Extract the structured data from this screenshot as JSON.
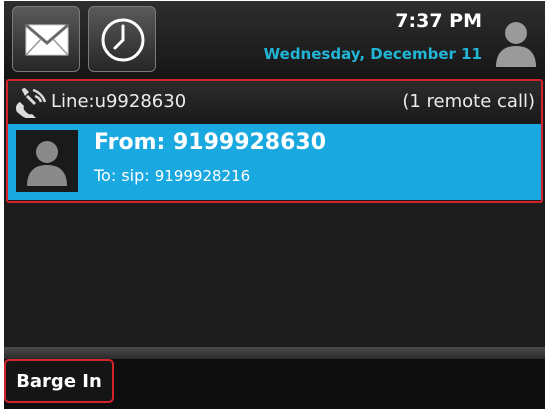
{
  "header": {
    "time": "7:37 PM",
    "date": "Wednesday, December 11",
    "buttons": [
      {
        "icon": "envelope-icon"
      },
      {
        "icon": "clock-icon"
      }
    ],
    "user_icon": "user-avatar-icon"
  },
  "line": {
    "label": "Line:u9928630",
    "remote_calls": "(1 remote call)",
    "icon": "phone-handset-icon"
  },
  "call": {
    "from": "From: 9199928630",
    "to_prefix": "To: sip:",
    "to_number": "9199928216",
    "avatar_icon": "caller-avatar-icon"
  },
  "softkeys": [
    {
      "label": "Barge In"
    }
  ],
  "colors": {
    "accent_blue": "#19a8e0",
    "date_color": "#22b6d6",
    "highlight_red": "#d4232b"
  }
}
